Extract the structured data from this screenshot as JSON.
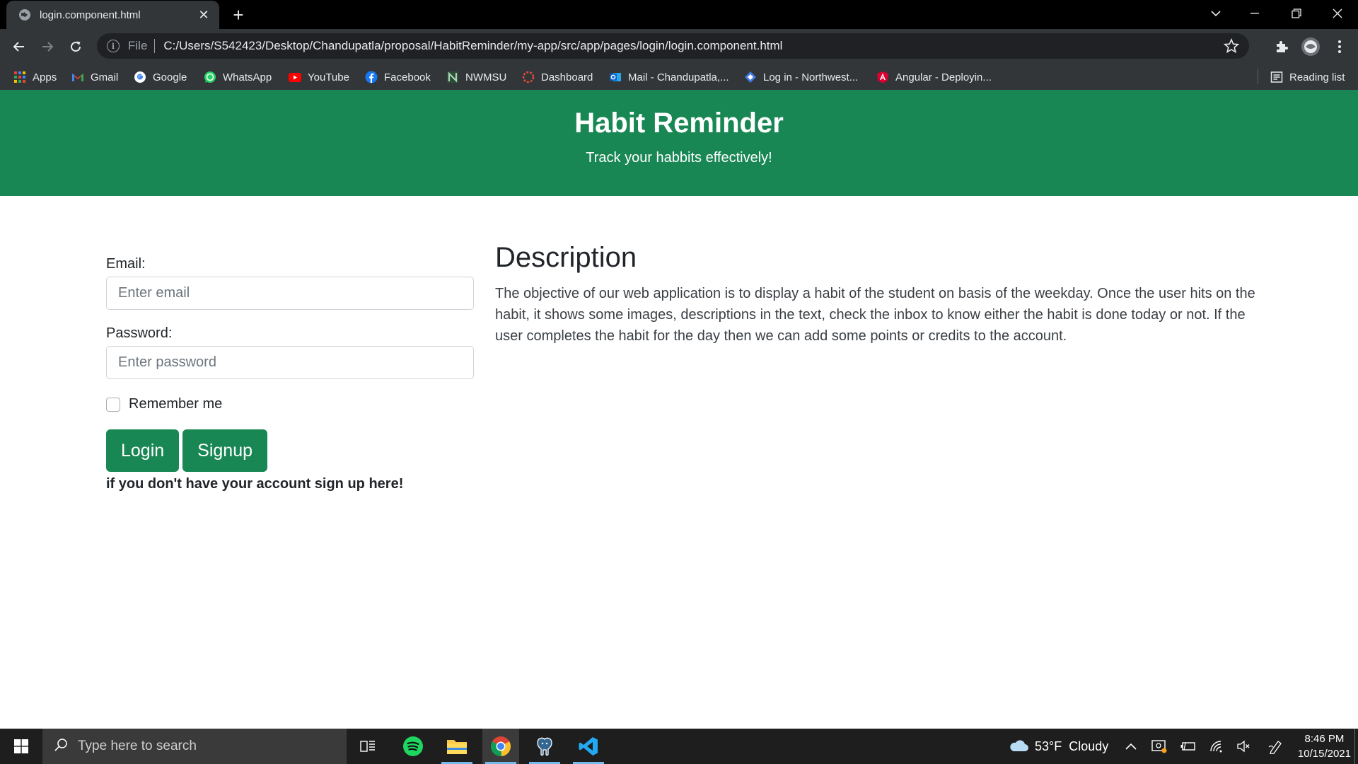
{
  "browser": {
    "tab_title": "login.component.html",
    "new_tab_label": "+",
    "url_scheme": "File",
    "url": "C:/Users/S542423/Desktop/Chandupatla/proposal/HabitReminder/my-app/src/app/pages/login/login.component.html",
    "bookmarks": [
      {
        "label": "Apps",
        "icon": "apps-grid-icon",
        "color": "#4285f4"
      },
      {
        "label": "Gmail",
        "icon": "gmail-icon",
        "color": "#ea4335"
      },
      {
        "label": "Google",
        "icon": "google-icon",
        "color": "#ffffff"
      },
      {
        "label": "WhatsApp",
        "icon": "whatsapp-icon",
        "color": "#25d366"
      },
      {
        "label": "YouTube",
        "icon": "youtube-icon",
        "color": "#ff0000"
      },
      {
        "label": "Facebook",
        "icon": "facebook-icon",
        "color": "#1877f2"
      },
      {
        "label": "NWMSU",
        "icon": "nwmsu-icon",
        "color": "#5fb36b"
      },
      {
        "label": "Dashboard",
        "icon": "dashboard-icon",
        "color": "#e34b3e"
      },
      {
        "label": "Mail - Chandupatla,...",
        "icon": "outlook-icon",
        "color": "#0a64c9"
      },
      {
        "label": "Log in - Northwest...",
        "icon": "login-diamond-icon",
        "color": "#3f7be6"
      },
      {
        "label": "Angular - Deployin...",
        "icon": "angular-icon",
        "color": "#dd0031"
      }
    ],
    "reading_list_label": "Reading list"
  },
  "hero": {
    "title": "Habit Reminder",
    "subtitle": "Track your habbits effectively!",
    "color": "#198754"
  },
  "login_form": {
    "email_label": "Email:",
    "email_placeholder": "Enter email",
    "email_value": "",
    "password_label": "Password:",
    "password_placeholder": "Enter password",
    "password_value": "",
    "remember_label": "Remember me",
    "remember_checked": false,
    "login_button": "Login",
    "signup_button": "Signup",
    "signup_hint": "if you don't have your account sign up here!"
  },
  "description": {
    "heading": "Description",
    "body": "The objective of our web application is to display a habit of the student on basis of the weekday. Once the user hits on the habit, it shows some images, descriptions in the text, check the inbox to know either the habit is done today or not. If the user completes the habit for the day then we can add some points or credits to the account."
  },
  "taskbar": {
    "search_placeholder": "Type here to search",
    "apps": [
      "task-view-icon",
      "spotify-icon",
      "file-explorer-icon",
      "chrome-icon",
      "postgresql-icon",
      "vscode-icon"
    ],
    "weather_temp": "53°F",
    "weather_text": "Cloudy",
    "time": "8:46 PM",
    "date": "10/15/2021"
  }
}
